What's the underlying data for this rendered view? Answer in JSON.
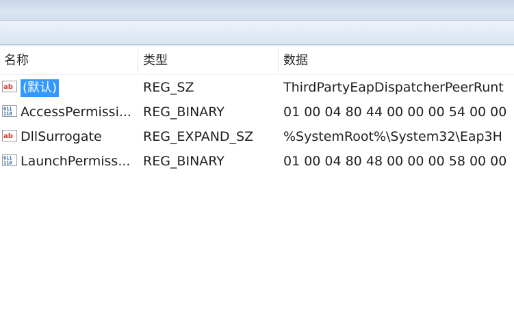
{
  "columns": {
    "name": "名称",
    "type": "类型",
    "data": "数据"
  },
  "rows": [
    {
      "icon": "string-value-icon",
      "name": "(默认)",
      "type": "REG_SZ",
      "data": "ThirdPartyEapDispatcherPeerRunt",
      "selected": true
    },
    {
      "icon": "binary-value-icon",
      "name": "AccessPermissi...",
      "type": "REG_BINARY",
      "data": "01 00 04 80 44 00 00 00 54 00 00",
      "selected": false
    },
    {
      "icon": "string-value-icon",
      "name": "DllSurrogate",
      "type": "REG_EXPAND_SZ",
      "data": "%SystemRoot%\\System32\\Eap3H",
      "selected": false
    },
    {
      "icon": "binary-value-icon",
      "name": "LaunchPermiss...",
      "type": "REG_BINARY",
      "data": "01 00 04 80 48 00 00 00 58 00 00",
      "selected": false
    }
  ],
  "colors": {
    "selection": "#3399ff",
    "string_icon": "#d23a2a",
    "binary_icon": "#2b5fae"
  }
}
